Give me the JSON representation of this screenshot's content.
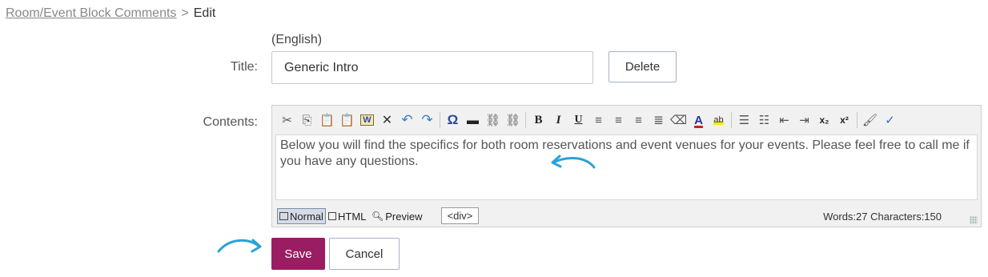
{
  "breadcrumb": {
    "parent": "Room/Event Block Comments",
    "separator": ">",
    "current": "Edit"
  },
  "form": {
    "language": "(English)",
    "title_label": "Title:",
    "title_value": "Generic Intro",
    "delete_label": "Delete",
    "contents_label": "Contents:",
    "contents_text": "Below you will find the specifics for both room reservations and event venues for your events.  Please feel free to call me if you have any questions.",
    "save_label": "Save",
    "cancel_label": "Cancel"
  },
  "editor": {
    "toolbar": [
      {
        "name": "cut-icon",
        "glyph": "✂"
      },
      {
        "name": "copy-icon",
        "glyph": "⎘"
      },
      {
        "name": "paste-icon",
        "glyph": "📋"
      },
      {
        "name": "paste-text-icon",
        "glyph": "📋"
      },
      {
        "name": "paste-word-icon",
        "glyph": "W"
      },
      {
        "name": "delete-icon",
        "glyph": "✕"
      },
      {
        "name": "undo-icon",
        "glyph": "↶"
      },
      {
        "name": "redo-icon",
        "glyph": "↷"
      },
      {
        "name": "sep"
      },
      {
        "name": "special-char-icon",
        "glyph": "Ω"
      },
      {
        "name": "horizontal-rule-icon",
        "glyph": "▬"
      },
      {
        "name": "link-icon",
        "glyph": "⛓"
      },
      {
        "name": "unlink-icon",
        "glyph": "⛓"
      },
      {
        "name": "sep"
      },
      {
        "name": "bold-icon",
        "glyph": "B"
      },
      {
        "name": "italic-icon",
        "glyph": "I"
      },
      {
        "name": "underline-icon",
        "glyph": "U"
      },
      {
        "name": "align-left-icon",
        "glyph": "≡"
      },
      {
        "name": "align-center-icon",
        "glyph": "≡"
      },
      {
        "name": "align-right-icon",
        "glyph": "≡"
      },
      {
        "name": "justify-icon",
        "glyph": "≣"
      },
      {
        "name": "eraser-icon",
        "glyph": "⌫"
      },
      {
        "name": "font-color-icon",
        "glyph": "A"
      },
      {
        "name": "highlight-icon",
        "glyph": "ab"
      },
      {
        "name": "sep"
      },
      {
        "name": "ordered-list-icon",
        "glyph": "☰"
      },
      {
        "name": "unordered-list-icon",
        "glyph": "☷"
      },
      {
        "name": "outdent-icon",
        "glyph": "⇤"
      },
      {
        "name": "indent-icon",
        "glyph": "⇥"
      },
      {
        "name": "subscript-icon",
        "glyph": "x₂"
      },
      {
        "name": "superscript-icon",
        "glyph": "x²"
      },
      {
        "name": "sep"
      },
      {
        "name": "format-painter-icon",
        "glyph": "🖌"
      },
      {
        "name": "spellcheck-icon",
        "glyph": "✓"
      }
    ],
    "modes": {
      "normal": "Normal",
      "html": "HTML",
      "preview": "Preview"
    },
    "tag": "<div>",
    "counts": "Words:27 Characters:150"
  },
  "colors": {
    "accent": "#9a1d63",
    "annotation": "#29a3d8"
  }
}
